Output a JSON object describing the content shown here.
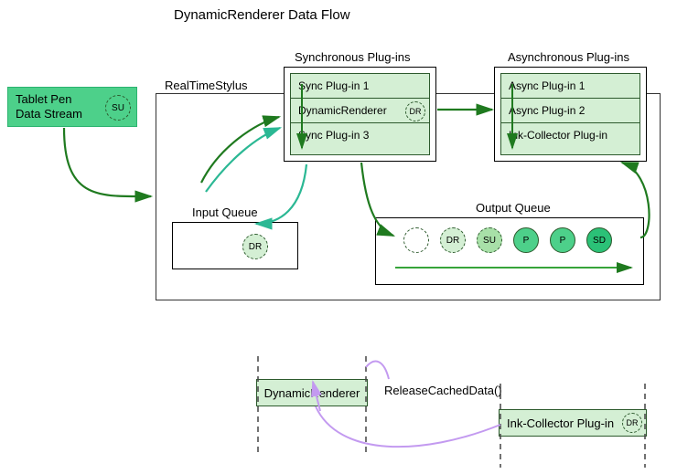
{
  "title": "DynamicRenderer Data Flow",
  "source": {
    "line1": "Tablet Pen",
    "line2": "Data Stream",
    "badge": "SU"
  },
  "rts": "RealTimeStylus",
  "sync": {
    "title": "Synchronous Plug-ins",
    "items": [
      "Sync Plug-in 1",
      "DynamicRenderer",
      "Sync Plug-in 3"
    ],
    "badge": "DR"
  },
  "async": {
    "title": "Asynchronous Plug-ins",
    "items": [
      "Async Plug-in 1",
      "Async Plug-in 2",
      "Ink-Collector Plug-in"
    ]
  },
  "inputQueue": {
    "title": "Input Queue",
    "badge": "DR"
  },
  "outputQueue": {
    "title": "Output Queue",
    "tokens": [
      "",
      "DR",
      "SU",
      "P",
      "P",
      "SD"
    ]
  },
  "bottom": {
    "dyn": "DynamicRenderer",
    "ink": "Ink-Collector Plug-in",
    "badge": "DR",
    "call": "ReleaseCachedData()"
  }
}
